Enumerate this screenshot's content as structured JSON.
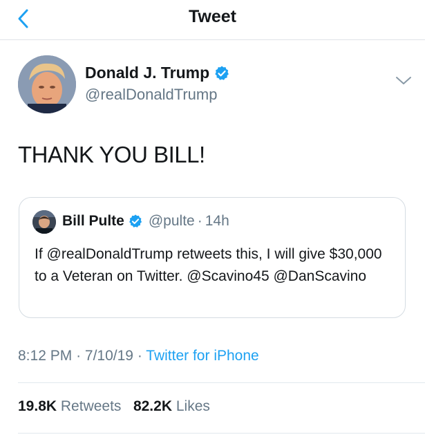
{
  "header": {
    "title": "Tweet"
  },
  "author": {
    "name": "Donald J. Trump",
    "handle": "@realDonaldTrump"
  },
  "tweet": {
    "text": "THANK YOU BILL!"
  },
  "quoted_tweet": {
    "name": "Bill Pulte",
    "handle": "@pulte",
    "separator": "·",
    "time": "14h",
    "text": "If @realDonaldTrump retweets this, I will give $30,000 to a Veteran on Twitter. @Scavino45 @DanScavino"
  },
  "meta": {
    "time": "8:12 PM",
    "separator": "·",
    "date": "7/10/19",
    "source": "Twitter for iPhone"
  },
  "stats": {
    "retweets_count": "19.8K",
    "retweets_label": "Retweets",
    "likes_count": "82.2K",
    "likes_label": "Likes"
  },
  "colors": {
    "accent": "#1da1f2",
    "secondary_text": "#657786",
    "primary_text": "#14171a"
  },
  "icons": {
    "back": "chevron-left-icon",
    "verified": "verified-badge-icon",
    "more": "chevron-down-icon"
  }
}
